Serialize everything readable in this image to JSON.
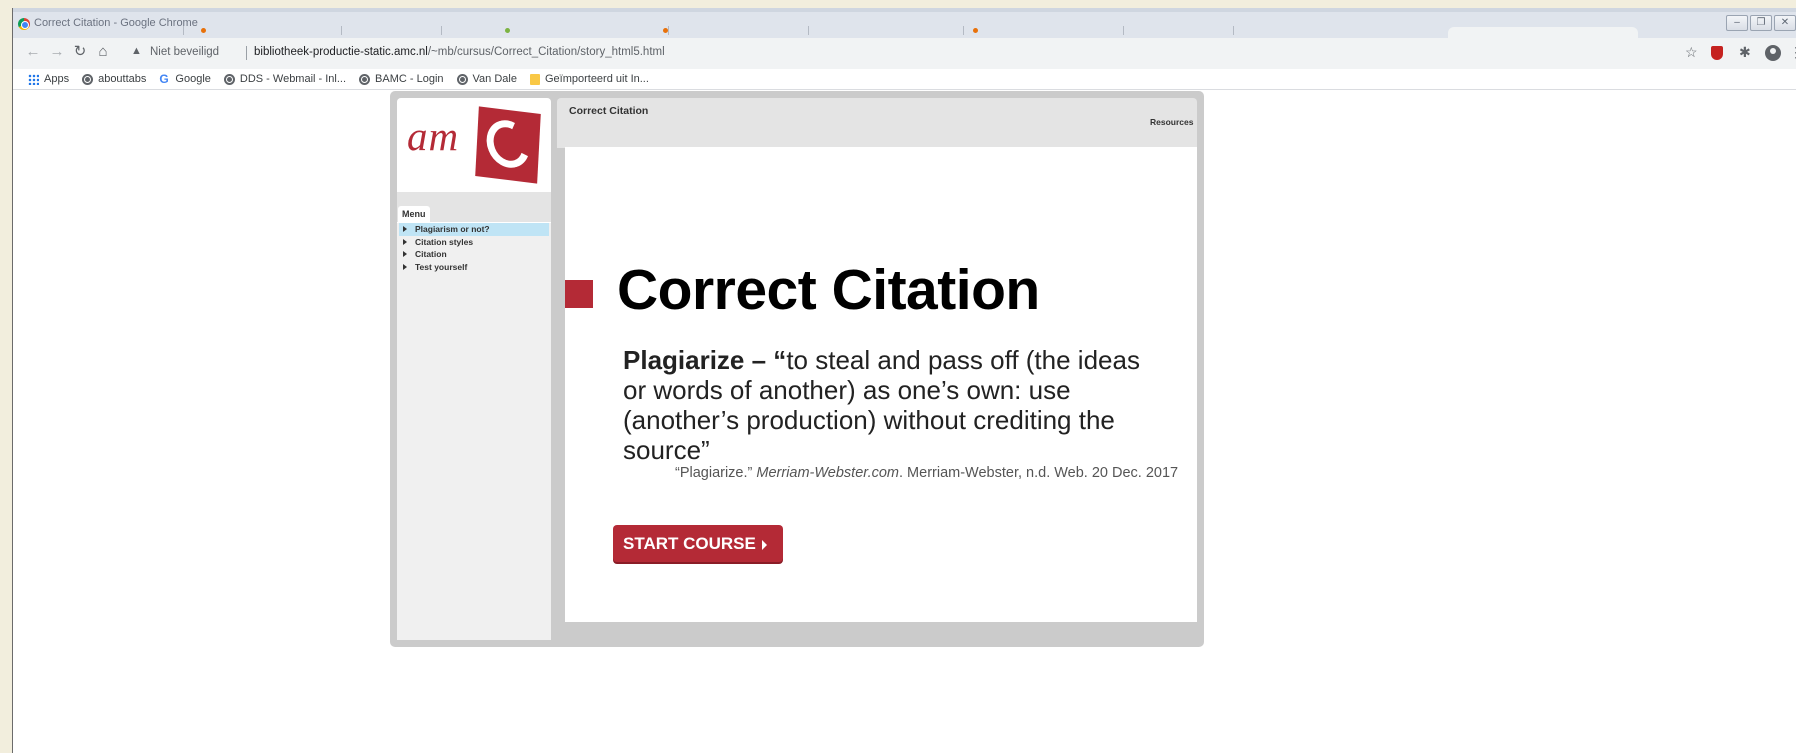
{
  "window": {
    "title": "Correct Citation - Google Chrome"
  },
  "toolbar": {
    "security_label": "Niet beveiligd",
    "url_host": "bibliotheek-productie-static.amc.nl",
    "url_path": "/~mb/cursus/Correct_Citation/story_html5.html"
  },
  "bookmarks": [
    {
      "label": "Apps",
      "icon": "apps-icon"
    },
    {
      "label": "abouttabs",
      "icon": "globe-icon"
    },
    {
      "label": "Google",
      "icon": "google-icon"
    },
    {
      "label": "DDS - Webmail - Inl...",
      "icon": "globe-icon"
    },
    {
      "label": "BAMC - Login",
      "icon": "globe-icon"
    },
    {
      "label": "Van Dale",
      "icon": "globe-icon"
    },
    {
      "label": "Geïmporteerd uit In...",
      "icon": "folder-icon"
    }
  ],
  "player": {
    "logo_text": "am",
    "course_title": "Correct Citation",
    "resources_label": "Resources",
    "menu_tab_label": "Menu",
    "menu_items": [
      {
        "label": "Plagiarism or not?",
        "selected": true
      },
      {
        "label": "Citation styles",
        "selected": false
      },
      {
        "label": "Citation",
        "selected": false
      },
      {
        "label": "Test yourself",
        "selected": false
      }
    ]
  },
  "slide": {
    "title": "Correct Citation",
    "definition_term": "Plagiarize – “",
    "definition_text": "to steal and pass off (the ideas or words of another) as one’s own: use (another’s production) without crediting the source”",
    "citation_prefix": "“Plagiarize.”",
    "citation_source": "Merriam-Webster.com",
    "citation_suffix": ". Merriam-Webster, n.d. Web. 20 Dec. 2017",
    "start_button_label": "START COURSE"
  },
  "colors": {
    "brand_red": "#b42a36",
    "menu_selected": "#bfe4f5"
  }
}
